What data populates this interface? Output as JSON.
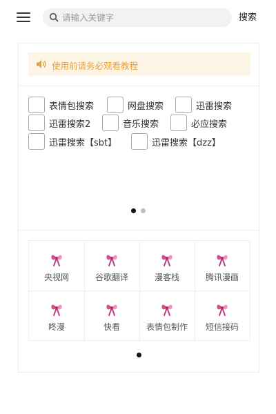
{
  "header": {
    "menu_icon": "hamburger-menu-icon",
    "search_placeholder": "请输入关键字",
    "search_button": "搜索"
  },
  "notice": {
    "icon": "speaker-icon",
    "text": "使用前请务必观看教程",
    "color": "#e6a23c",
    "background": "#fdf6e6"
  },
  "search_options": [
    {
      "label": "表情包搜索",
      "checked": false
    },
    {
      "label": "网盘搜索",
      "checked": false
    },
    {
      "label": "迅雷搜索",
      "checked": false
    },
    {
      "label": "迅雷搜索2",
      "checked": false
    },
    {
      "label": "音乐搜索",
      "checked": false
    },
    {
      "label": "必应搜索",
      "checked": false
    },
    {
      "label": "迅雷搜索【sbt】",
      "checked": false
    },
    {
      "label": "迅雷搜索【dzz】",
      "checked": false
    }
  ],
  "options_pager": {
    "pages": 2,
    "active": 1
  },
  "apps": [
    {
      "label": "央视网",
      "icon": "pink-bow-icon"
    },
    {
      "label": "谷歌翻译",
      "icon": "pink-bow-icon"
    },
    {
      "label": "漫客栈",
      "icon": "pink-bow-icon"
    },
    {
      "label": "腾讯漫画",
      "icon": "pink-bow-icon"
    },
    {
      "label": "咚漫",
      "icon": "pink-bow-icon"
    },
    {
      "label": "快看",
      "icon": "pink-bow-icon"
    },
    {
      "label": "表情包制作",
      "icon": "pink-bow-icon"
    },
    {
      "label": "短信接码",
      "icon": "pink-bow-icon"
    }
  ],
  "apps_pager": {
    "pages": 1,
    "active": 1
  },
  "colors": {
    "accent_pink": "#d14b8f",
    "dot_active": "#111111",
    "dot_inactive": "#bdbdbd"
  }
}
